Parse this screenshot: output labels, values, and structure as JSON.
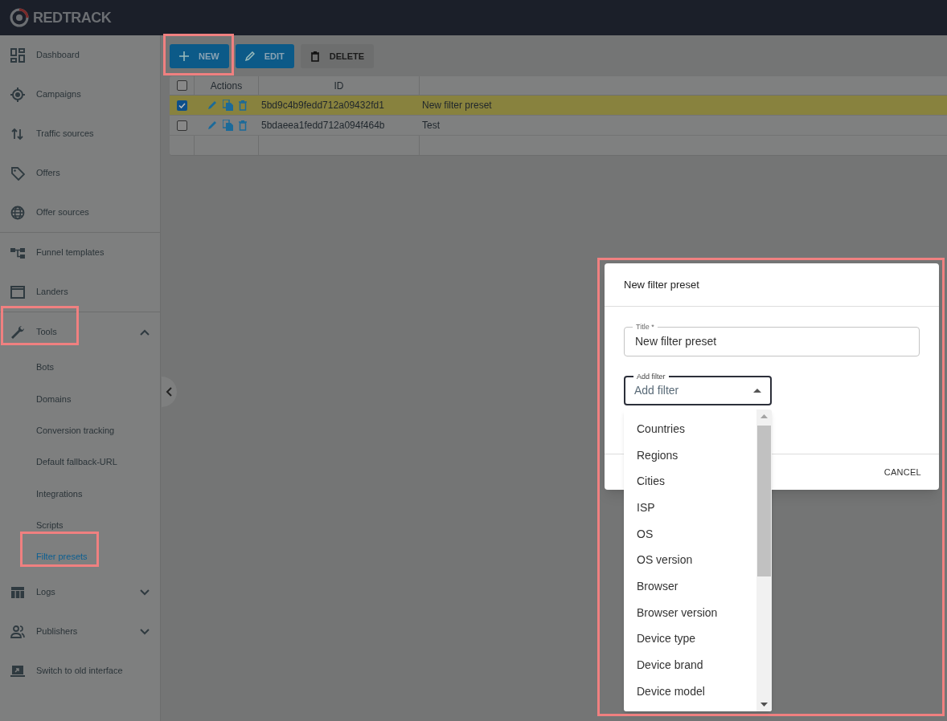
{
  "header": {
    "logo": "REDTRACK"
  },
  "sidebar": {
    "sections": [
      [
        {
          "label": "Dashboard",
          "selected": false
        },
        {
          "label": "Campaigns",
          "selected": false
        },
        {
          "label": "Traffic sources",
          "selected": false
        },
        {
          "label": "Offers",
          "selected": false
        },
        {
          "label": "Offer sources",
          "selected": false
        }
      ],
      [
        {
          "label": "Funnel templates",
          "selected": false
        },
        {
          "label": "Landers",
          "selected": false
        }
      ],
      [
        {
          "label": "Tools",
          "selected": false,
          "expanded": true,
          "children": [
            {
              "label": "Bots",
              "selected": false
            },
            {
              "label": "Domains",
              "selected": false
            },
            {
              "label": "Conversion tracking",
              "selected": false
            },
            {
              "label": "Default fallback-URL",
              "selected": false
            },
            {
              "label": "Integrations",
              "selected": false
            },
            {
              "label": "Scripts",
              "selected": false
            },
            {
              "label": "Filter presets",
              "selected": true
            }
          ]
        },
        {
          "label": "Logs",
          "selected": false,
          "expanded": false
        },
        {
          "label": "Publishers",
          "selected": false,
          "expanded": false
        },
        {
          "label": "Switch to old interface",
          "selected": false
        }
      ]
    ]
  },
  "toolbar": [
    {
      "label": "NEW",
      "kind": "primary"
    },
    {
      "label": "EDIT",
      "kind": "primary"
    },
    {
      "label": "DELETE",
      "kind": "secondary"
    }
  ],
  "table": {
    "select_all_checked": false,
    "columns": [
      "Actions",
      "ID"
    ],
    "rows": [
      {
        "checked": true,
        "id": "5bd9c4b9fedd712a09432fd1",
        "name": "New filter preset"
      },
      {
        "checked": false,
        "id": "5bdaeea1fedd712a094f464b",
        "name": "Test"
      }
    ]
  },
  "dialog": {
    "title": "New filter preset",
    "title_field": {
      "label": "Title *",
      "value": "New filter preset"
    },
    "filter_select": {
      "label": "Add filter",
      "placeholder": "Add filter",
      "expanded": true,
      "options": [
        "Countries",
        "Regions",
        "Cities",
        "ISP",
        "OS",
        "OS version",
        "Browser",
        "Browser version",
        "Device type",
        "Device brand",
        "Device model"
      ]
    },
    "buttons": [
      "CANCEL"
    ]
  }
}
